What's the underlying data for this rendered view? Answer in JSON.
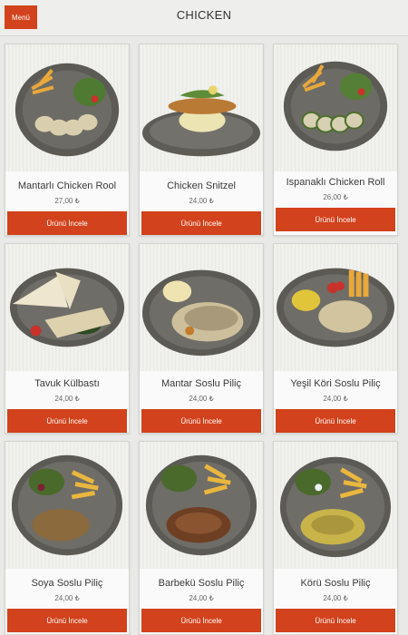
{
  "header": {
    "menu_label": "Menü",
    "title": "CHICKEN"
  },
  "colors": {
    "accent": "#d2421c",
    "background": "#e9e9e7"
  },
  "products": [
    {
      "name": "Mantarlı Chicken Rool",
      "price": "27,00 ₺",
      "button": "Ürünü İncele",
      "plate": "dark-grey",
      "items": [
        "fries",
        "salad",
        "sliced-chicken"
      ]
    },
    {
      "name": "Chicken Snitzel",
      "price": "24,00 ₺",
      "button": "Ürünü İncele",
      "plate": "flat-grey",
      "items": [
        "schnitzel",
        "mashed-potato",
        "greens"
      ]
    },
    {
      "name": "Ispanaklı Chicken Roll",
      "price": "26,00 ₺",
      "button": "Ürünü İncele",
      "plate": "dark-grey",
      "items": [
        "fries",
        "salad",
        "chicken-roll"
      ]
    },
    {
      "name": "Tavuk Külbastı",
      "price": "24,00 ₺",
      "button": "Ürünü İncele",
      "plate": "dark-grey",
      "items": [
        "lavash",
        "grilled-chicken",
        "tomato"
      ]
    },
    {
      "name": "Mantar Soslu Piliç",
      "price": "24,00 ₺",
      "button": "Ürünü İncele",
      "plate": "dark-grey",
      "items": [
        "rice",
        "mushroom-sauce-chicken"
      ]
    },
    {
      "name": "Yeşil Köri Soslu Piliç",
      "price": "24,00 ₺",
      "button": "Ürünü İncele",
      "plate": "dark-grey",
      "items": [
        "rice",
        "fries",
        "curry-chicken"
      ]
    },
    {
      "name": "Soya Soslu Piliç",
      "price": "24,00 ₺",
      "button": "Ürünü İncele",
      "plate": "dark-grey",
      "items": [
        "salad",
        "fries",
        "soy-chicken"
      ]
    },
    {
      "name": "Barbekü Soslu Piliç",
      "price": "24,00 ₺",
      "button": "Ürünü İncele",
      "plate": "dark-grey",
      "items": [
        "salad",
        "fries",
        "bbq-chicken"
      ]
    },
    {
      "name": "Körü Soslu Piliç",
      "price": "24,00 ₺",
      "button": "Ürünü İncele",
      "plate": "dark-grey",
      "items": [
        "salad",
        "fries",
        "curry-chicken"
      ]
    }
  ]
}
